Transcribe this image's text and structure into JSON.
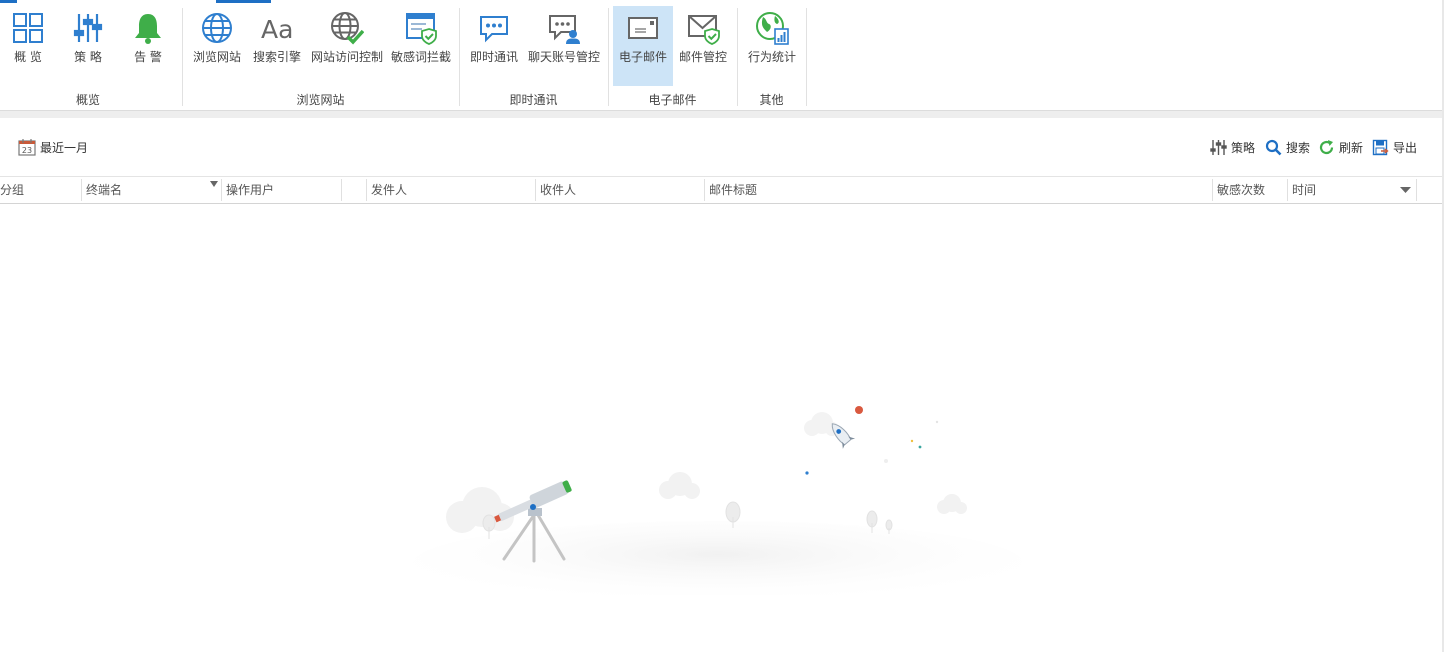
{
  "ribbon": {
    "groups": [
      {
        "label": "概览"
      },
      {
        "label": "浏览网站"
      },
      {
        "label": "即时通讯"
      },
      {
        "label": "电子邮件"
      },
      {
        "label": "其他"
      }
    ],
    "buttons": [
      {
        "label": "概 览",
        "icon": "grid-icon"
      },
      {
        "label": "策 略",
        "icon": "sliders-icon"
      },
      {
        "label": "告 警",
        "icon": "bell-icon"
      },
      {
        "label": "浏览网站",
        "icon": "globe-icon"
      },
      {
        "label": "搜索引擎",
        "icon": "font-aa-icon"
      },
      {
        "label": "网站访问控制",
        "icon": "globe-check-icon"
      },
      {
        "label": "敏感词拦截",
        "icon": "window-shield-icon"
      },
      {
        "label": "即时通讯",
        "icon": "chat-bubble-icon"
      },
      {
        "label": "聊天账号管控",
        "icon": "chat-user-icon"
      },
      {
        "label": "电子邮件",
        "icon": "envelope-icon",
        "active": true
      },
      {
        "label": "邮件管控",
        "icon": "envelope-shield-icon"
      },
      {
        "label": "行为统计",
        "icon": "globe-stats-icon"
      }
    ]
  },
  "toolbar": {
    "date_range": "最近一月",
    "date_icon_text": "23",
    "policy": "策略",
    "search": "搜索",
    "refresh": "刷新",
    "export": "导出"
  },
  "table": {
    "columns": [
      "分组",
      "终端名",
      "操作用户",
      "发件人",
      "收件人",
      "邮件标题",
      "敏感次数",
      "时间"
    ],
    "rows": []
  },
  "colors": {
    "accent": "#1e6fc4",
    "active_bg": "#cde4f7",
    "green": "#3fae49"
  }
}
